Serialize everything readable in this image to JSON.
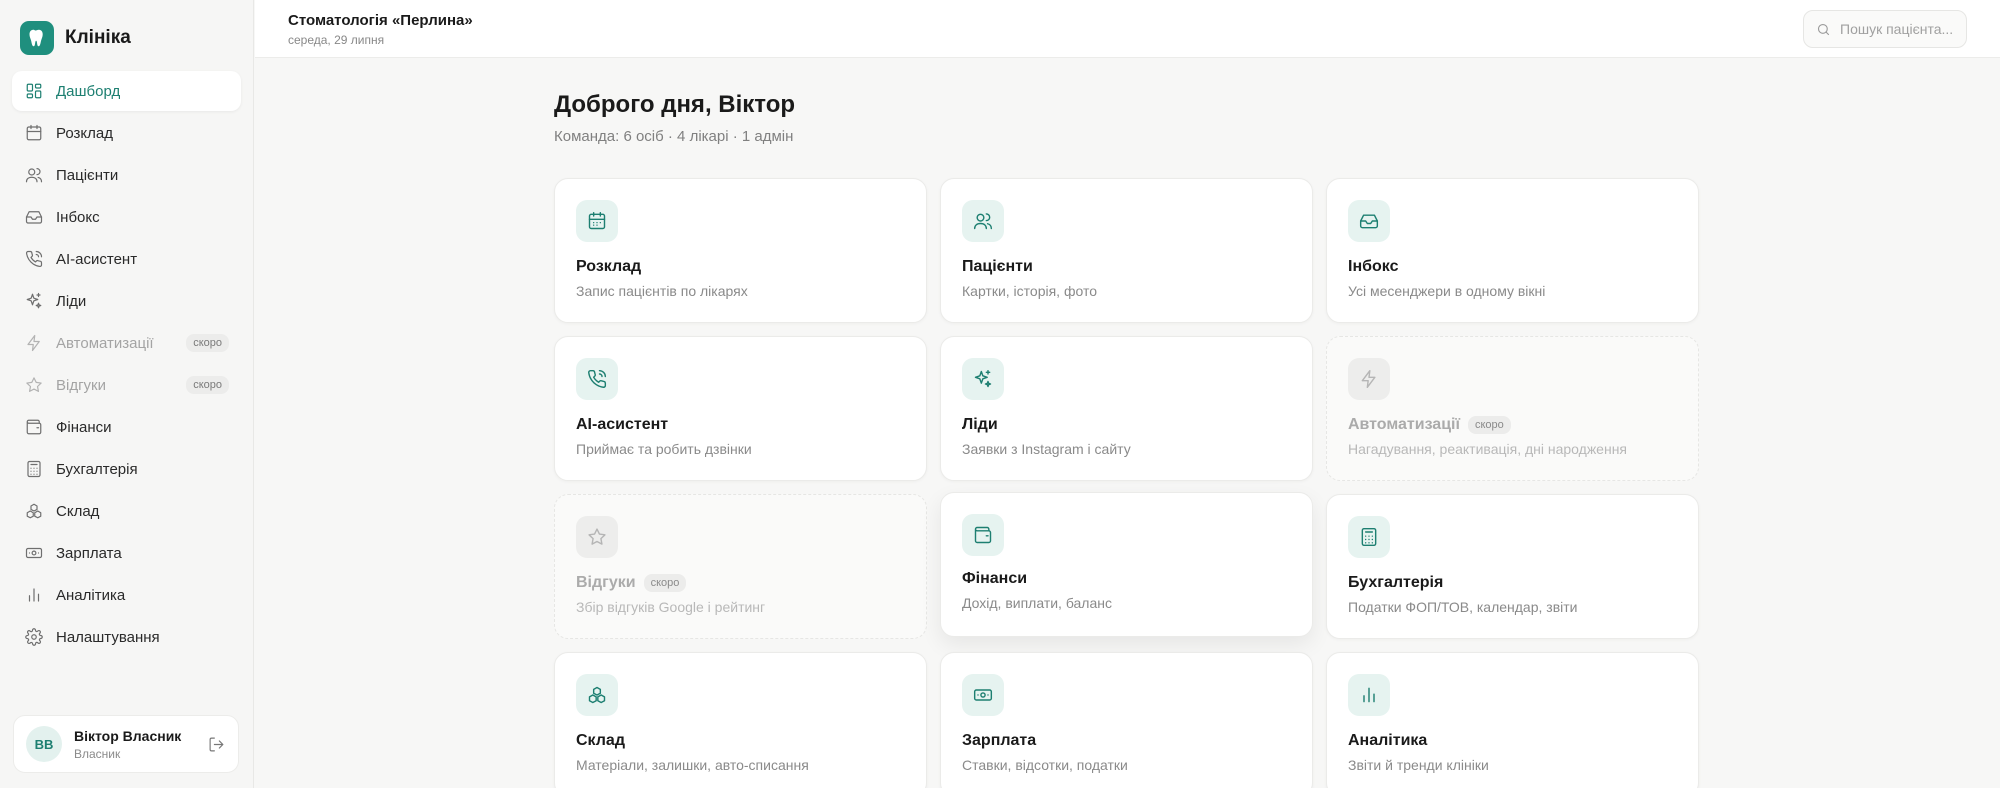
{
  "brand": {
    "name": "Клініка",
    "icon": "tooth-icon",
    "color": "#1f8f7e"
  },
  "sidebar": {
    "items": [
      {
        "label": "Дашборд",
        "icon": "grid-icon",
        "active": true
      },
      {
        "label": "Розклад",
        "icon": "calendar-icon"
      },
      {
        "label": "Пацієнти",
        "icon": "users-icon"
      },
      {
        "label": "Інбокс",
        "icon": "inbox-icon"
      },
      {
        "label": "AI-асистент",
        "icon": "phone-icon"
      },
      {
        "label": "Ліди",
        "icon": "sparkles-icon"
      },
      {
        "label": "Автоматизації",
        "icon": "lightning-icon",
        "badge": "скоро",
        "disabled": true
      },
      {
        "label": "Відгуки",
        "icon": "star-icon",
        "badge": "скоро",
        "disabled": true
      },
      {
        "label": "Фінанси",
        "icon": "wallet-icon"
      },
      {
        "label": "Бухгалтерія",
        "icon": "calculator-icon"
      },
      {
        "label": "Склад",
        "icon": "boxes-icon"
      },
      {
        "label": "Зарплата",
        "icon": "banknote-icon"
      },
      {
        "label": "Аналітика",
        "icon": "bar-chart-icon"
      },
      {
        "label": "Налаштування",
        "icon": "gear-icon"
      }
    ]
  },
  "user": {
    "initials": "ВВ",
    "name": "Віктор Власник",
    "role": "Власник"
  },
  "header": {
    "clinic": "Стоматологія «Перлина»",
    "date": "середа, 29 липня",
    "search_placeholder": "Пошук пацієнта..."
  },
  "main": {
    "greeting": "Доброго дня, Віктор",
    "team": "Команда: 6 осіб · 4 лікарі · 1 адмін",
    "cards": [
      {
        "title": "Розклад",
        "desc": "Запис пацієнтів по лікарях",
        "icon": "calendar-icon"
      },
      {
        "title": "Пацієнти",
        "desc": "Картки, історія, фото",
        "icon": "users-icon"
      },
      {
        "title": "Інбокс",
        "desc": "Усі месенджери в одному вікні",
        "icon": "inbox-icon"
      },
      {
        "title": "AI-асистент",
        "desc": "Приймає та робить дзвінки",
        "icon": "phone-icon"
      },
      {
        "title": "Ліди",
        "desc": "Заявки з Instagram і сайту",
        "icon": "sparkles-icon"
      },
      {
        "title": "Автоматизації",
        "desc": "Нагадування, реактивація, дні народження",
        "icon": "lightning-icon",
        "badge": "скоро",
        "disabled": true
      },
      {
        "title": "Відгуки",
        "desc": "Збір відгуків Google і рейтинг",
        "icon": "star-icon",
        "badge": "скоро",
        "disabled": true
      },
      {
        "title": "Фінанси",
        "desc": "Дохід, виплати, баланс",
        "icon": "wallet-icon"
      },
      {
        "title": "Бухгалтерія",
        "desc": "Податки ФОП/ТОВ, календар, звіти",
        "icon": "calculator-icon"
      },
      {
        "title": "Склад",
        "desc": "Матеріали, залишки, авто-списання",
        "icon": "boxes-icon"
      },
      {
        "title": "Зарплата",
        "desc": "Ставки, відсотки, податки",
        "icon": "banknote-icon"
      },
      {
        "title": "Аналітика",
        "desc": "Звіти й тренди клініки",
        "icon": "bar-chart-icon"
      }
    ]
  },
  "colors": {
    "accent": "#1d7f71",
    "accent_soft": "#e6f3f0"
  }
}
